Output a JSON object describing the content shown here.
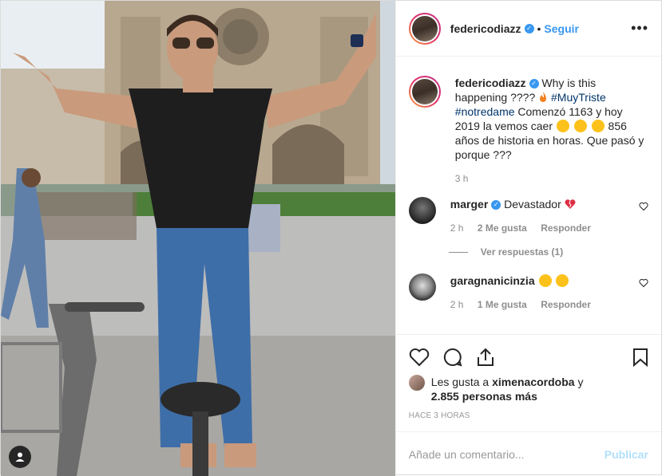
{
  "post": {
    "author": "federicodiazz",
    "follow_label": "Seguir",
    "more_label": "•••",
    "caption": {
      "user": "federicodiazz",
      "text_1": "Why is this happening ????",
      "hashtag_1": "#MuyTriste",
      "hashtag_2": "#notredame",
      "text_2": "Comenzó 1163 y hoy 2019 la vemos caer",
      "text_3": "856 años de historia en horas. Que pasó y porque ???",
      "time": "3 h"
    },
    "comments": [
      {
        "user": "marger",
        "text": "Devastador",
        "time": "2 h",
        "likes": "2 Me gusta",
        "reply_label": "Responder",
        "view_replies": "Ver respuestas (1)"
      },
      {
        "user": "garagnanicinzia",
        "text": "",
        "time": "2 h",
        "likes": "1 Me gusta",
        "reply_label": "Responder"
      }
    ],
    "likes_text_1": "Les gusta a",
    "likes_user": "ximenacordoba",
    "likes_text_2": "y",
    "likes_count": "2.855 personas más",
    "posted": "HACE 3 HORAS",
    "comment_placeholder": "Añade un comentario...",
    "publish_label": "Publicar"
  },
  "colors": {
    "accent": "#3897f0",
    "publish_disabled": "#b2dffc",
    "text": "#262626",
    "muted": "#8e8e8e"
  },
  "icons": [
    "heart-icon",
    "comment-icon",
    "share-icon",
    "bookmark-icon",
    "verified-icon",
    "user-tag-icon"
  ]
}
